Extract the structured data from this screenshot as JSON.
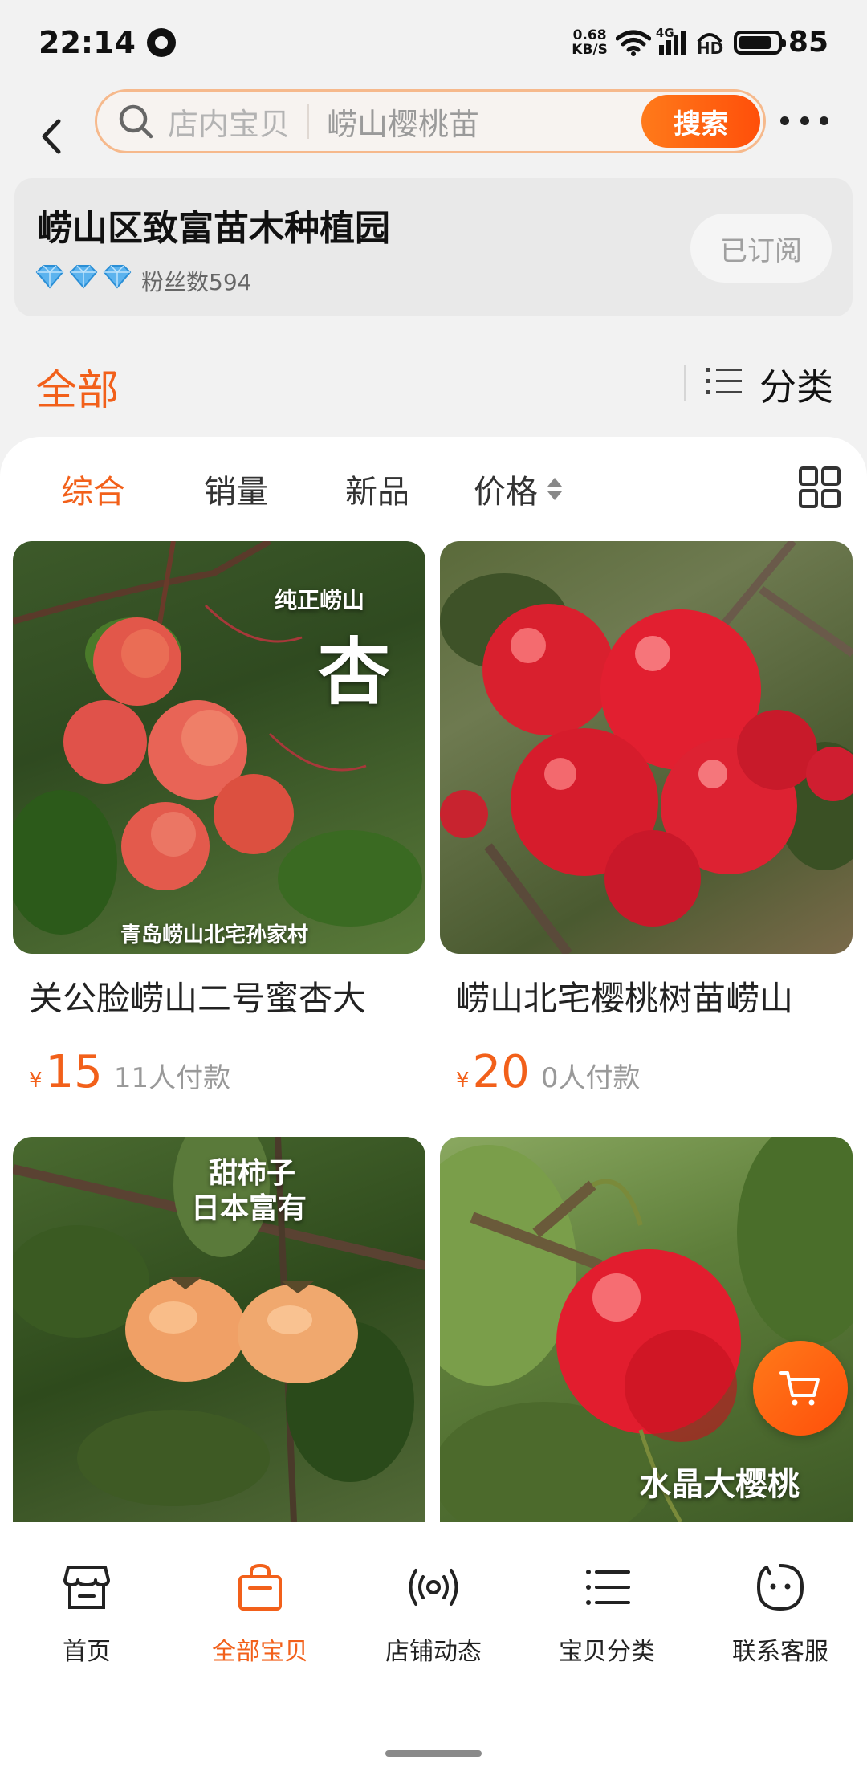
{
  "status_bar": {
    "time": "22:14",
    "net_speed_value": "0.68",
    "net_speed_unit": "KB/S",
    "network_type": "4G",
    "hd_label": "HD",
    "battery": "85",
    "battery_level": 0.85
  },
  "search": {
    "placeholder": "店内宝贝",
    "value": "崂山樱桃苗",
    "button_label": "搜索"
  },
  "shop": {
    "name": "崂山区致富苗木种植园",
    "fans": "粉丝数594",
    "subscribe_label": "已订阅"
  },
  "category": {
    "all_label": "全部",
    "classify_label": "分类"
  },
  "sort": {
    "items": [
      "综合",
      "销量",
      "新品"
    ],
    "price_label": "价格"
  },
  "products": [
    {
      "title": "关公脸崂山二号蜜杏大",
      "currency": "¥",
      "price": "15",
      "paid": "11人付款",
      "overlay_top": "纯正崂山",
      "overlay_big": "杏",
      "overlay_bottom": "青岛崂山北宅孙家村"
    },
    {
      "title": "崂山北宅樱桃树苗崂山",
      "currency": "¥",
      "price": "20",
      "paid": "0人付款"
    },
    {
      "overlay_line1": "甜柿子",
      "overlay_line2": "日本富有"
    },
    {
      "overlay_bottom": "水晶大樱桃"
    }
  ],
  "bottom_nav": [
    {
      "label": "首页",
      "icon": "shop-home-icon"
    },
    {
      "label": "全部宝贝",
      "icon": "shopping-bag-icon"
    },
    {
      "label": "店铺动态",
      "icon": "broadcast-icon"
    },
    {
      "label": "宝贝分类",
      "icon": "list-icon"
    },
    {
      "label": "联系客服",
      "icon": "chat-face-icon"
    }
  ],
  "colors": {
    "accent": "#f2601a",
    "search_button": "#ff5a10",
    "background": "#f2f2f2"
  }
}
